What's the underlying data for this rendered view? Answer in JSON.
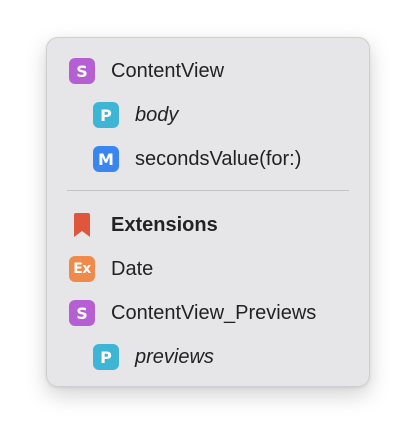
{
  "menu": {
    "items": [
      {
        "label": "ContentView",
        "badge": "S",
        "kind": "struct",
        "color": "#b65fd5"
      },
      {
        "label": "body",
        "badge": "P",
        "kind": "property",
        "color": "#3fb5d6"
      },
      {
        "label": "secondsValue(for:)",
        "badge": "M",
        "kind": "method",
        "color": "#3a86f1"
      }
    ],
    "mark": {
      "label": "Extensions",
      "icon": "bookmark-icon",
      "color": "#e0563d"
    },
    "extensions": [
      {
        "label": "Date",
        "badge": "Ex",
        "kind": "extension",
        "color": "#ef8a4a"
      },
      {
        "label": "ContentView_Previews",
        "badge": "S",
        "kind": "struct",
        "color": "#b65fd5"
      },
      {
        "label": "previews",
        "badge": "P",
        "kind": "property",
        "color": "#3fb5d6"
      }
    ]
  }
}
